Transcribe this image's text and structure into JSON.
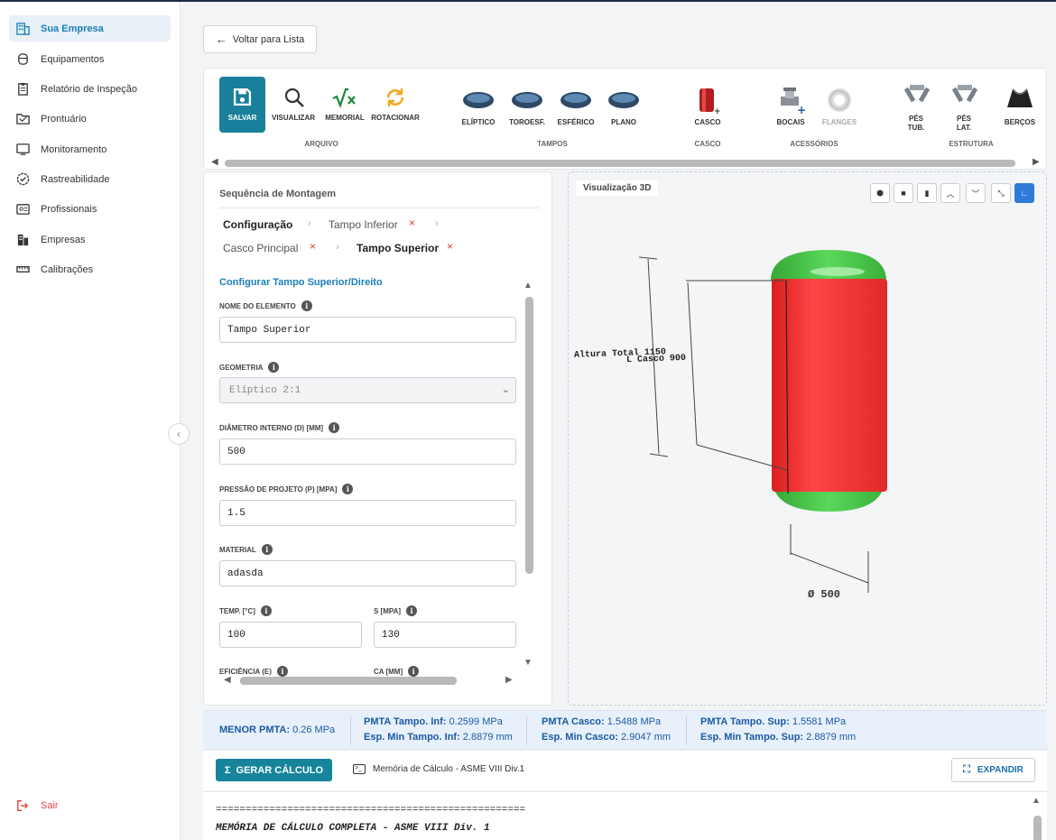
{
  "sidebar": {
    "items": [
      {
        "label": "Sua Empresa",
        "icon": "building-icon"
      },
      {
        "label": "Equipamentos",
        "icon": "tank-icon"
      },
      {
        "label": "Relatório de Inspeção",
        "icon": "clipboard-icon"
      },
      {
        "label": "Prontuário",
        "icon": "folder-icon"
      },
      {
        "label": "Monitoramento",
        "icon": "monitor-icon"
      },
      {
        "label": "Rastreabilidade",
        "icon": "badge-check-icon"
      },
      {
        "label": "Profissionais",
        "icon": "id-card-icon"
      },
      {
        "label": "Empresas",
        "icon": "buildings-icon"
      },
      {
        "label": "Calibrações",
        "icon": "ruler-icon"
      }
    ],
    "logout": "Sair"
  },
  "back_button": "Voltar para Lista",
  "toolbar": {
    "save": "SALVAR",
    "visualize": "VISUALIZAR",
    "memorial": "MEMORIAL",
    "rotate": "ROTACIONAR",
    "elliptic": "ELÍPTICO",
    "torisph": "TOROESF.",
    "spheric": "ESFÉRICO",
    "flat": "PLANO",
    "shell": "CASCO",
    "nozzles": "BOCAIS",
    "flanges": "FLANGES",
    "legs_tub_1": "PÉS",
    "legs_tub_2": "TUB.",
    "legs_lat_1": "PÉS",
    "legs_lat_2": "LAT.",
    "cradles": "BERÇOS",
    "groups": {
      "file": "ARQUIVO",
      "heads": "TAMPOS",
      "shell": "CASCO",
      "accessories": "ACESSÓRIOS",
      "structure": "ESTRUTURA"
    }
  },
  "assembly": {
    "title": "Sequência de Montagem",
    "steps": {
      "config": "Configuração",
      "lower_head": "Tampo Inferior",
      "main_shell": "Casco Principal",
      "upper_head": "Tampo Superior"
    },
    "remove_glyph": "×",
    "chevron_glyph": "›"
  },
  "form": {
    "title": "Configurar Tampo Superior/Direito",
    "element_name_label": "NOME DO ELEMENTO",
    "element_name": "Tampo Superior",
    "geometry_label": "GEOMETRIA",
    "geometry": "Elíptico 2:1",
    "diameter_label": "DIÂMETRO INTERNO (D) [MM]",
    "diameter": "500",
    "pressure_label": "PRESSÃO DE PROJETO (P) [MPA]",
    "pressure": "1.5",
    "material_label": "MATERIAL",
    "material": "adasda",
    "temp_label": "TEMP. [°C]",
    "temp": "100",
    "s_label": "S [MPA]",
    "s": "130",
    "efficiency_label": "EFICIÊNCIA (E)",
    "ca_label": "CA [MM]",
    "info_glyph": "i"
  },
  "viz": {
    "title": "Visualização 3D",
    "total_height": "Altura Total 1150",
    "shell_length": "L Casco 900",
    "diameter": "Ø 500",
    "shell_color": "#ff3b3b",
    "head_color": "#4cc44c"
  },
  "results": {
    "min_pmta_label": "MENOR PMTA:",
    "min_pmta": "0.26 MPa",
    "pmta_lower_label": "PMTA Tampo. Inf:",
    "pmta_lower": "0.2599 MPa",
    "esp_lower_label": "Esp. Min Tampo. Inf:",
    "esp_lower": "2.8879 mm",
    "pmta_shell_label": "PMTA Casco:",
    "pmta_shell": "1.5488 MPa",
    "esp_shell_label": "Esp. Min Casco:",
    "esp_shell": "2.9047 mm",
    "pmta_upper_label": "PMTA Tampo. Sup:",
    "pmta_upper": "1.5581 MPa",
    "esp_upper_label": "Esp. Min Tampo. Sup:",
    "esp_upper": "2.8879 mm"
  },
  "calc": {
    "generate": "GERAR CÁLCULO",
    "generate_glyph": "Σ",
    "memory_tab": "Memória de Cálculo - ASME VIII Div.1",
    "expand": "EXPANDIR",
    "line1": "====================================================",
    "line2": "MEMÓRIA DE CÁLCULO COMPLETA - ASME VIII Div. 1"
  },
  "accent_color": "#1a7f9a"
}
